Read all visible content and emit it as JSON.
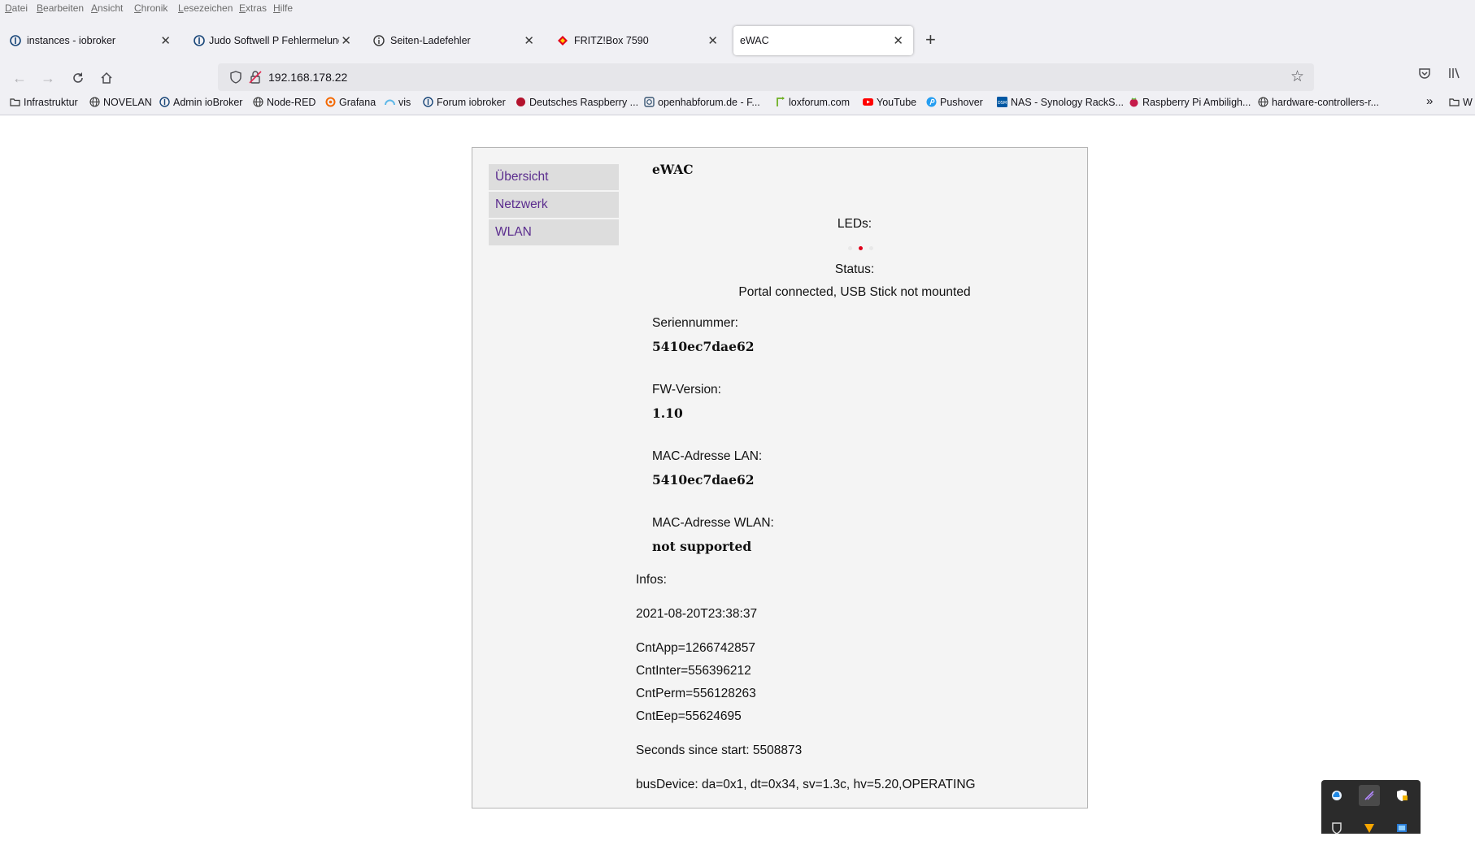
{
  "menu": [
    "Datei",
    "Bearbeiten",
    "Ansicht",
    "Chronik",
    "Lesezeichen",
    "Extras",
    "Hilfe"
  ],
  "tabs": [
    {
      "label": "instances - iobroker",
      "icon": "iobroker-icon",
      "active": false
    },
    {
      "label": "Judo Softwell P Fehlermelung a",
      "icon": "iobroker-icon",
      "active": false
    },
    {
      "label": "Seiten-Ladefehler",
      "icon": "info-icon",
      "active": false
    },
    {
      "label": "FRITZ!Box 7590",
      "icon": "fritzbox-icon",
      "active": false
    },
    {
      "label": "eWAC",
      "icon": "",
      "active": true
    }
  ],
  "url": "192.168.178.22",
  "bookmarks": [
    {
      "label": "Infrastruktur",
      "icon": "folder-icon"
    },
    {
      "label": "NOVELAN",
      "icon": "globe-icon"
    },
    {
      "label": "Admin ioBroker",
      "icon": "iobroker-icon"
    },
    {
      "label": "Node-RED",
      "icon": "globe-icon"
    },
    {
      "label": "Grafana",
      "icon": "grafana-icon"
    },
    {
      "label": "vis",
      "icon": "vis-icon"
    },
    {
      "label": "Forum iobroker",
      "icon": "iobroker-icon"
    },
    {
      "label": "Deutsches Raspberry ...",
      "icon": "raspberry-icon"
    },
    {
      "label": "openhabforum.de - F...",
      "icon": "openhab-icon"
    },
    {
      "label": "loxforum.com",
      "icon": "loxone-icon"
    },
    {
      "label": "YouTube",
      "icon": "youtube-icon"
    },
    {
      "label": "Pushover",
      "icon": "pushover-icon"
    },
    {
      "label": "NAS - Synology RackS...",
      "icon": "synology-icon"
    },
    {
      "label": "Raspberry Pi Ambiligh...",
      "icon": "raspberry-pi-icon"
    },
    {
      "label": "hardware-controllers-r...",
      "icon": "globe-icon"
    }
  ],
  "bookmarks_overflow": "W",
  "page": {
    "nav": [
      "Übersicht",
      "Netzwerk",
      "WLAN"
    ],
    "title": "eWAC",
    "leds_label": "LEDs:",
    "leds": [
      {
        "color": "#e8e8e8"
      },
      {
        "color": "#e0001a"
      },
      {
        "color": "#e8e8e8"
      }
    ],
    "status_label": "Status:",
    "status_value": "Portal connected, USB Stick not mounted",
    "serial_label": "Seriennummer:",
    "serial_value": "5410ec7dae62",
    "fw_label": "FW-Version:",
    "fw_value": "1.10",
    "mac_lan_label": "MAC-Adresse LAN:",
    "mac_lan_value": "5410ec7dae62",
    "mac_wlan_label": "MAC-Adresse WLAN:",
    "mac_wlan_value": "not supported",
    "infos_label": "Infos:",
    "timestamp": "2021-08-20T23:38:37",
    "counters": [
      "CntApp=1266742857",
      "CntInter=556396212",
      "CntPerm=556128263",
      "CntEep=55624695"
    ],
    "seconds": "Seconds since start: 5508873",
    "bus_device": "busDevice: da=0x1, dt=0x34, sv=1.3c, hv=5.20,OPERATING"
  }
}
